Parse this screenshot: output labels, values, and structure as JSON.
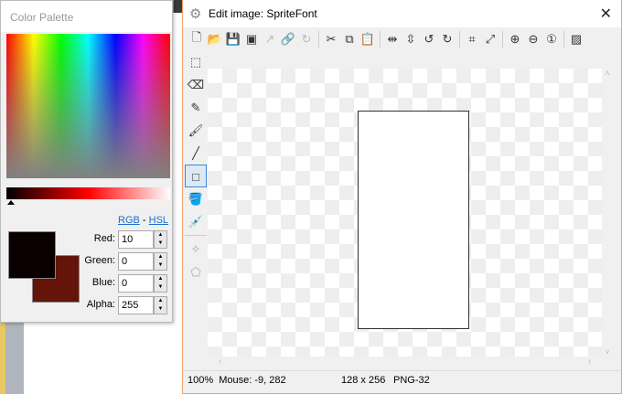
{
  "palette": {
    "title": "Color Palette",
    "links": {
      "rgb": "RGB",
      "sep": "-",
      "hsl": "HSL"
    },
    "primary_color": "#0a0000",
    "secondary_color": "#641408",
    "fields": [
      {
        "label": "Red:",
        "value": "10"
      },
      {
        "label": "Green:",
        "value": "0"
      },
      {
        "label": "Blue:",
        "value": "0"
      },
      {
        "label": "Alpha:",
        "value": "255"
      }
    ]
  },
  "editor": {
    "title": "Edit image: SpriteFont",
    "close": "✕",
    "toolbar": [
      "new-icon",
      "open-icon",
      "save-icon",
      "save-as-icon",
      "export-icon",
      "link-icon",
      "refresh-icon",
      "cut-icon",
      "copy-icon",
      "paste-icon",
      "flip-horizontal-icon",
      "flip-vertical-icon",
      "rotate-left-icon",
      "rotate-right-icon",
      "crop-icon",
      "resize-icon",
      "zoom-in-icon",
      "zoom-out-icon",
      "zoom-actual-icon",
      "background-icon"
    ],
    "tools": [
      "select",
      "eraser",
      "pencil",
      "brush",
      "line",
      "rectangle",
      "fill",
      "eyedropper",
      "point",
      "polygon"
    ],
    "selected_tool": "rectangle",
    "status": {
      "zoom": "100%",
      "mouse": "Mouse: -9, 282",
      "size": "128 x 256",
      "format": "PNG-32"
    }
  }
}
